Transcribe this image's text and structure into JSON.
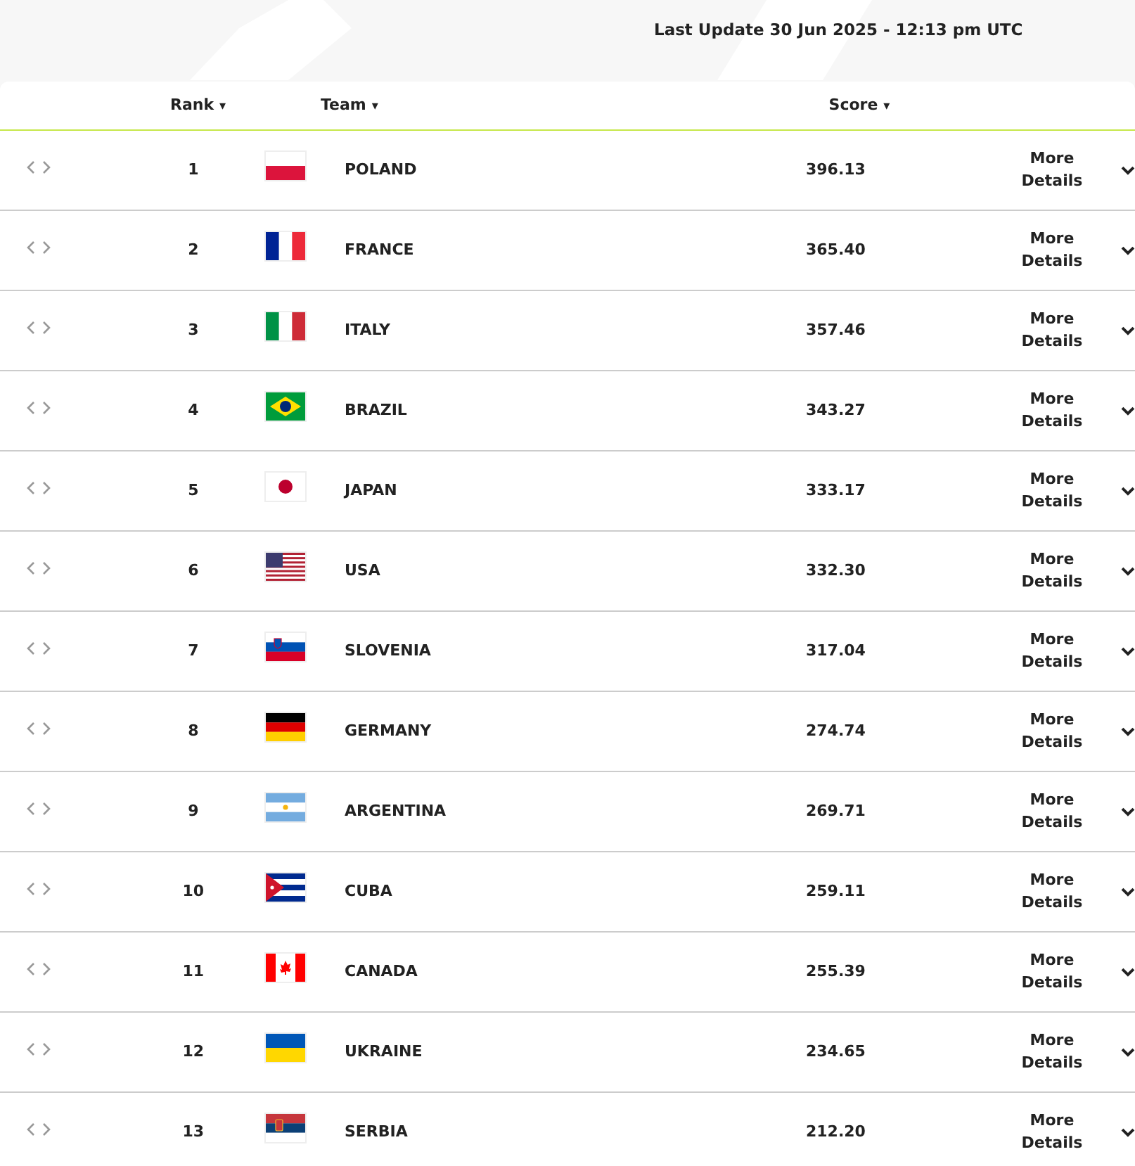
{
  "last_update": "Last Update 30 Jun 2025 - 12:13 pm UTC",
  "columns": [
    {
      "label": "Rank",
      "sort": "▾"
    },
    {
      "label": "Team",
      "sort": "▾"
    },
    {
      "label": "Score",
      "sort": "▾"
    }
  ],
  "rows": [
    {
      "rank": "1",
      "kind": "pl",
      "team": "POLAND",
      "score": "396.13",
      "details": "More Details"
    },
    {
      "rank": "2",
      "kind": "fr",
      "team": "FRANCE",
      "score": "365.40",
      "details": "More Details"
    },
    {
      "rank": "3",
      "kind": "it",
      "team": "ITALY",
      "score": "357.46",
      "details": "More Details"
    },
    {
      "rank": "4",
      "kind": "br",
      "team": "BRAZIL",
      "score": "343.27",
      "details": "More Details"
    },
    {
      "rank": "5",
      "kind": "jp",
      "team": "JAPAN",
      "score": "333.17",
      "details": "More Details"
    },
    {
      "rank": "6",
      "kind": "us",
      "team": "USA",
      "score": "332.30",
      "details": "More Details"
    },
    {
      "rank": "7",
      "kind": "si",
      "team": "SLOVENIA",
      "score": "317.04",
      "details": "More Details"
    },
    {
      "rank": "8",
      "kind": "de",
      "team": "GERMANY",
      "score": "274.74",
      "details": "More Details"
    },
    {
      "rank": "9",
      "kind": "ar",
      "team": "ARGENTINA",
      "score": "269.71",
      "details": "More Details"
    },
    {
      "rank": "10",
      "kind": "cu",
      "team": "CUBA",
      "score": "259.11",
      "details": "More Details"
    },
    {
      "rank": "11",
      "kind": "ca",
      "team": "CANADA",
      "score": "255.39",
      "details": "More Details"
    },
    {
      "rank": "12",
      "kind": "ua",
      "team": "UKRAINE",
      "score": "234.65",
      "details": "More Details"
    },
    {
      "rank": "13",
      "kind": "rs",
      "team": "SERBIA",
      "score": "212.20",
      "details": "More Details"
    }
  ]
}
